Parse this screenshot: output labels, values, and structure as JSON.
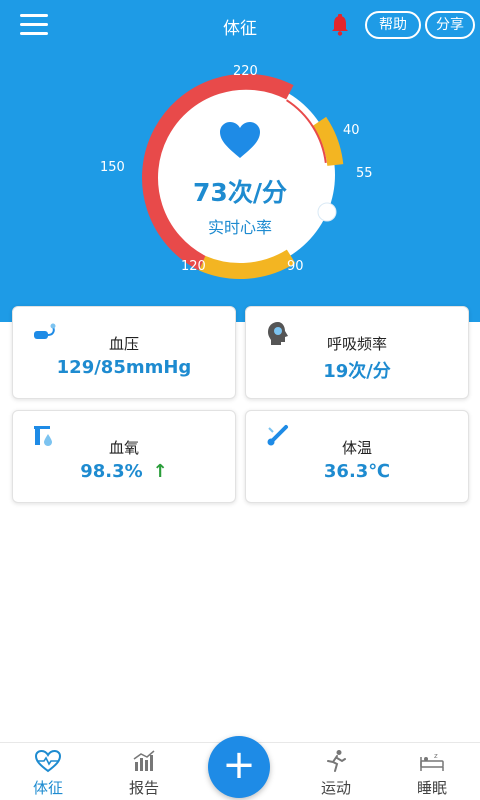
{
  "header": {
    "title": "体征",
    "help_label": "帮助",
    "share_label": "分享",
    "icons": [
      "menu-icon",
      "bell-icon"
    ]
  },
  "gauge": {
    "value_text": "73次/分",
    "label": "实时心率",
    "ticks": {
      "t220": "220",
      "t150": "150",
      "t120": "120",
      "t90": "90",
      "t55": "55",
      "t40": "40"
    },
    "colors": {
      "red": "#e84a4a",
      "yellow": "#f3b522",
      "primary": "#1e9be6"
    }
  },
  "cards": {
    "blood_pressure": {
      "label": "血压",
      "value": "129/85mmHg",
      "icon": "blood-pressure-icon"
    },
    "respiration": {
      "label": "呼吸频率",
      "value": "19次/分",
      "icon": "head-icon"
    },
    "spo2": {
      "label": "血氧",
      "value": "98.3%",
      "trend": "↑",
      "icon": "blood-oxygen-icon"
    },
    "temperature": {
      "label": "体温",
      "value": "36.3℃",
      "icon": "thermometer-icon"
    }
  },
  "nav": {
    "vitals": "体征",
    "report": "报告",
    "add": "+",
    "exercise": "运动",
    "sleep": "睡眠"
  }
}
